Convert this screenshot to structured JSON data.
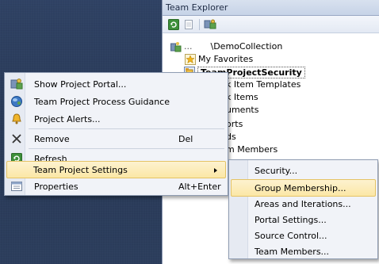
{
  "team_explorer": {
    "title": "Team Explorer",
    "collection": "\\DemoCollection",
    "collection_prefix": "...",
    "tree": [
      {
        "label": "My Favorites"
      },
      {
        "label": "TeamProjectSecurity"
      },
      {
        "label": "k Item Templates"
      },
      {
        "label": "k Items"
      },
      {
        "label": "uments"
      },
      {
        "label": "orts"
      },
      {
        "label": "ds"
      },
      {
        "label": "m Members"
      }
    ]
  },
  "context_menu": {
    "items": [
      {
        "label": "Show Project Portal...",
        "icon": "portal-icon"
      },
      {
        "label": "Team Project Process Guidance",
        "icon": "guidance-icon"
      },
      {
        "label": "Project Alerts...",
        "icon": "alerts-icon"
      },
      {
        "label": "Remove",
        "icon": "remove-icon",
        "shortcut": "Del"
      },
      {
        "label": "Refresh",
        "icon": "refresh-icon"
      },
      {
        "label": "Team Project Settings",
        "icon": "",
        "has_submenu": true
      },
      {
        "label": "Properties",
        "icon": "properties-icon",
        "shortcut": "Alt+Enter"
      }
    ]
  },
  "submenu": {
    "items": [
      {
        "label": "Security..."
      },
      {
        "label": "Group Membership..."
      },
      {
        "label": "Areas and Iterations..."
      },
      {
        "label": "Portal Settings..."
      },
      {
        "label": "Source Control..."
      },
      {
        "label": "Team Members..."
      }
    ]
  },
  "colors": {
    "highlight": "#fbe7a6",
    "highlight_border": "#e5c365",
    "menu_bg": "#f1f3f8",
    "ide_bg": "#2b3c59"
  }
}
